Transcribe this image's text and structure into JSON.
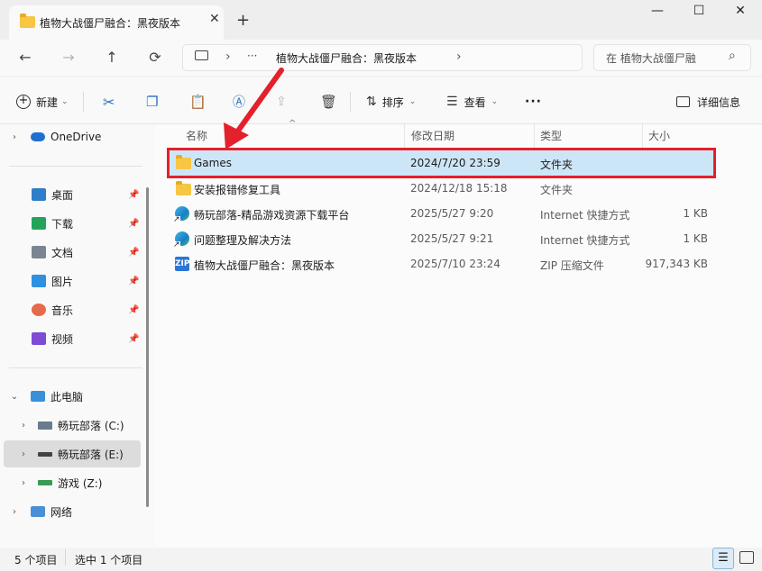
{
  "window": {
    "tab_title": "植物大战僵尸融合：黑夜版本",
    "tab_close": "✕",
    "new_tab": "+",
    "minimize": "—",
    "maximize": "☐",
    "close": "✕"
  },
  "nav": {
    "back": "←",
    "forward": "→",
    "up": "↑",
    "refresh": "⟳"
  },
  "address": {
    "more": "···",
    "sep1": "›",
    "path": "植物大战僵尸融合：黑夜版本",
    "sep2": "›"
  },
  "search": {
    "placeholder": "在 植物大战僵尸融",
    "icon": "⌕"
  },
  "toolbar": {
    "new_label": "新建",
    "sort_label": "排序",
    "view_label": "查看",
    "more": "···",
    "details_label": "详细信息",
    "caret": "⌄"
  },
  "sidebar": {
    "onedrive": "OneDrive",
    "quick": [
      {
        "label": "桌面",
        "icon": "desktop-icon",
        "color": "#2f7ec8"
      },
      {
        "label": "下载",
        "icon": "download-icon",
        "color": "#22a55a"
      },
      {
        "label": "文档",
        "icon": "document-icon",
        "color": "#7a8591"
      },
      {
        "label": "图片",
        "icon": "pictures-icon",
        "color": "#2f8fe0"
      },
      {
        "label": "音乐",
        "icon": "music-icon",
        "color": "#e46a4a"
      },
      {
        "label": "视频",
        "icon": "video-icon",
        "color": "#7f4ad6"
      }
    ],
    "this_pc": "此电脑",
    "drives": [
      {
        "label": "畅玩部落 (C:)"
      },
      {
        "label": "畅玩部落 (E:)"
      },
      {
        "label": "游戏 (Z:)"
      }
    ],
    "network": "网络"
  },
  "columns": {
    "name": "名称",
    "date": "修改日期",
    "type": "类型",
    "size": "大小",
    "sort_caret": "^"
  },
  "files": [
    {
      "name": "Games",
      "date": "2024/7/20 23:59",
      "type": "文件夹",
      "size": "",
      "icon": "folder-icon"
    },
    {
      "name": "安装报错修复工具",
      "date": "2024/12/18 15:18",
      "type": "文件夹",
      "size": "",
      "icon": "folder-icon"
    },
    {
      "name": "畅玩部落-精品游戏资源下载平台",
      "date": "2025/5/27 9:20",
      "type": "Internet 快捷方式",
      "size": "1 KB",
      "icon": "internet-shortcut-icon"
    },
    {
      "name": "问题整理及解决方法",
      "date": "2025/5/27 9:21",
      "type": "Internet 快捷方式",
      "size": "1 KB",
      "icon": "internet-shortcut-icon"
    },
    {
      "name": "植物大战僵尸融合：黑夜版本",
      "date": "2025/7/10 23:24",
      "type": "ZIP 压缩文件",
      "size": "917,343 KB",
      "icon": "zip-icon"
    }
  ],
  "status": {
    "count": "5 个项目",
    "selected": "选中 1 个项目"
  },
  "colors": {
    "selection": "#cde6f7",
    "highlight_box": "#e4202c",
    "arrow": "#e4202c"
  }
}
